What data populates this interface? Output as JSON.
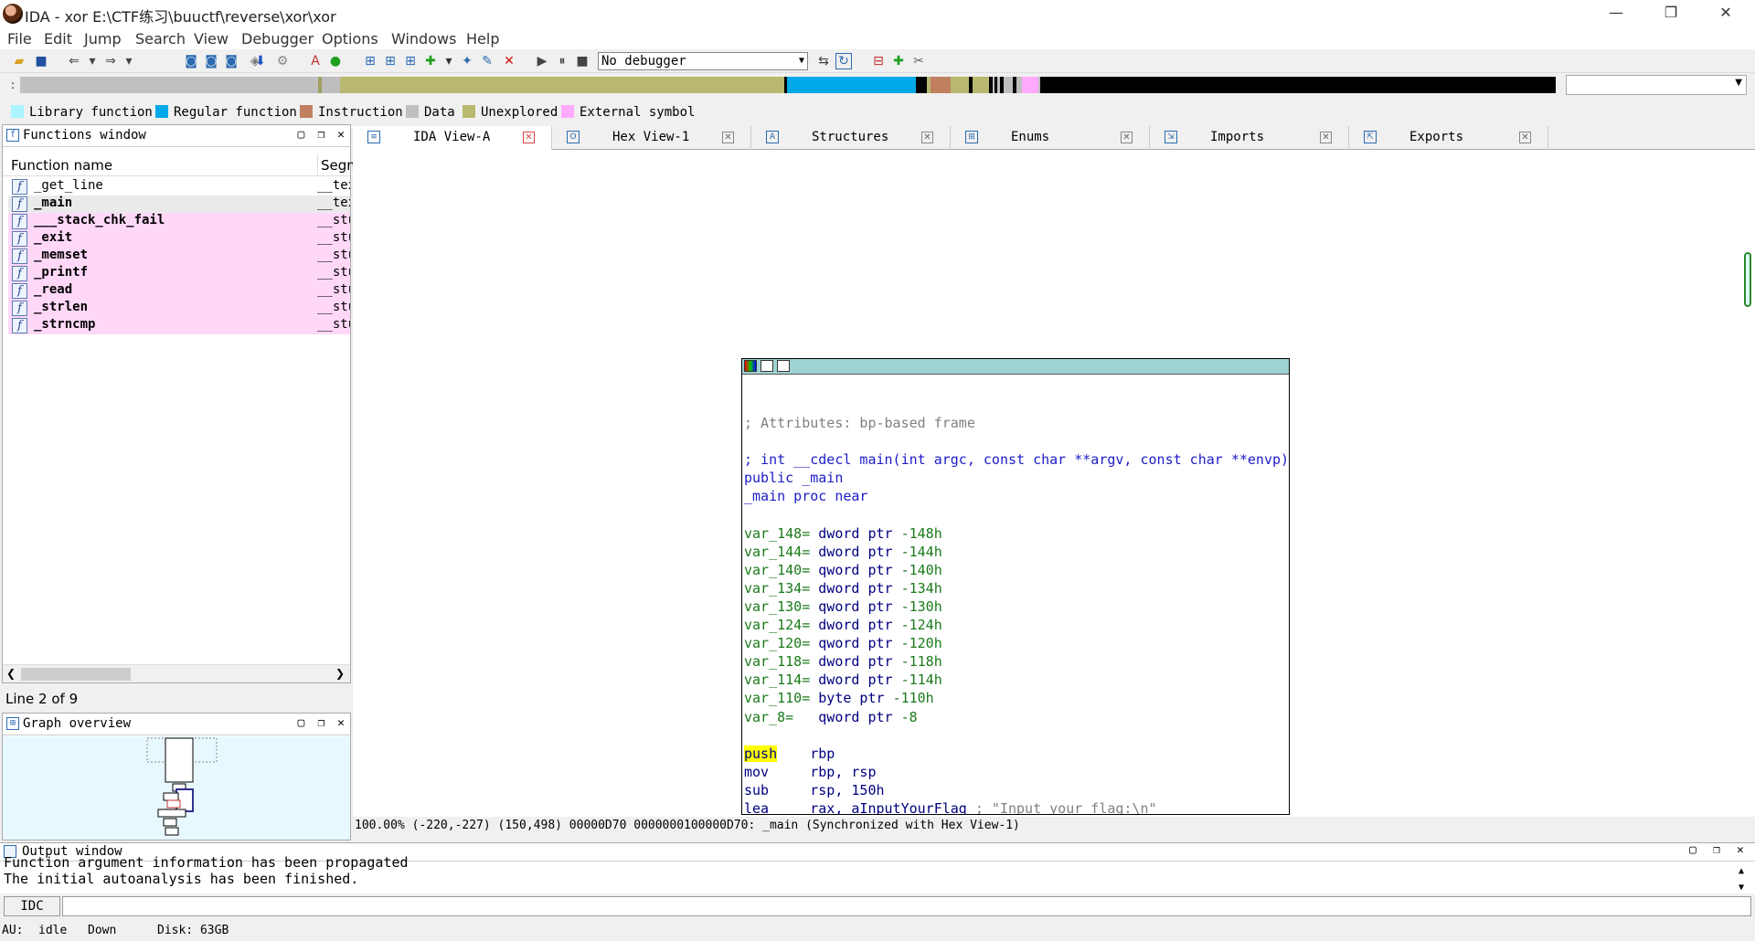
{
  "window": {
    "title": "IDA - xor E:\\CTF练习\\buuctf\\reverse\\xor\\xor",
    "minimize": "—",
    "restore": "❐",
    "close": "✕"
  },
  "menu": [
    "File",
    "Edit",
    "Jump",
    "Search",
    "View",
    "Debugger",
    "Options",
    "Windows",
    "Help"
  ],
  "toolbar": {
    "debugger_select": "No debugger"
  },
  "legend": [
    {
      "label": "Library function",
      "color": "#aaf5ff"
    },
    {
      "label": "Regular function",
      "color": "#00a8e8"
    },
    {
      "label": "Instruction",
      "color": "#c08060"
    },
    {
      "label": "Data",
      "color": "#c0c0c0"
    },
    {
      "label": "Unexplored",
      "color": "#b8b870"
    },
    {
      "label": "External symbol",
      "color": "#ffaaff"
    }
  ],
  "functions_window": {
    "title": "Functions window",
    "col_name": "Function name",
    "col_segment": "Segm",
    "rows": [
      {
        "name": "_get_line",
        "segment": "__text",
        "style": "plain"
      },
      {
        "name": "_main",
        "segment": "__text",
        "style": "sel"
      },
      {
        "name": "___stack_chk_fail",
        "segment": "__stubs",
        "style": "pink"
      },
      {
        "name": "_exit",
        "segment": "__stubs",
        "style": "pink"
      },
      {
        "name": "_memset",
        "segment": "__stubs",
        "style": "pink"
      },
      {
        "name": "_printf",
        "segment": "__stubs",
        "style": "pink"
      },
      {
        "name": "_read",
        "segment": "__stubs",
        "style": "pink"
      },
      {
        "name": "_strlen",
        "segment": "__stubs",
        "style": "pink"
      },
      {
        "name": "_strncmp",
        "segment": "__stubs",
        "style": "pink"
      }
    ],
    "line_status": "Line 2 of 9"
  },
  "graph_overview": {
    "title": "Graph overview"
  },
  "tabs": [
    {
      "label": "IDA View-A",
      "active": true
    },
    {
      "label": "Hex View-1",
      "active": false
    },
    {
      "label": "Structures",
      "active": false
    },
    {
      "label": "Enums",
      "active": false
    },
    {
      "label": "Imports",
      "active": false
    },
    {
      "label": "Exports",
      "active": false
    }
  ],
  "asm": {
    "attr": "; Attributes: bp-based frame",
    "proto": "; int __cdecl main(int argc, const char **argv, const char **envp)",
    "public": "public _main",
    "proc": "_main proc near",
    "vars": [
      {
        "name": "var_148",
        "type": "dword ptr",
        "off": "-148h"
      },
      {
        "name": "var_144",
        "type": "dword ptr",
        "off": "-144h"
      },
      {
        "name": "var_140",
        "type": "qword ptr",
        "off": "-140h"
      },
      {
        "name": "var_134",
        "type": "dword ptr",
        "off": "-134h"
      },
      {
        "name": "var_130",
        "type": "qword ptr",
        "off": "-130h"
      },
      {
        "name": "var_124",
        "type": "dword ptr",
        "off": "-124h"
      },
      {
        "name": "var_120",
        "type": "qword ptr",
        "off": "-120h"
      },
      {
        "name": "var_118",
        "type": "dword ptr",
        "off": "-118h"
      },
      {
        "name": "var_114",
        "type": "dword ptr",
        "off": "-114h"
      },
      {
        "name": "var_110",
        "type": "byte ptr",
        "off": "-110h"
      },
      {
        "name": "var_8",
        "type": "qword ptr",
        "off": "-8"
      }
    ],
    "instructions": [
      {
        "op": "push",
        "args": "rbp",
        "comment": ""
      },
      {
        "op": "mov",
        "args": "rbp, rsp",
        "comment": ""
      },
      {
        "op": "sub",
        "args": "rsp, 150h",
        "comment": ""
      },
      {
        "op": "lea",
        "args": "rax, aInputYourFlag",
        "comment": "; \"Input your flag:\\n\""
      }
    ]
  },
  "view_status": "100.00% (-220,-227) (150,498) 00000D70 0000000100000D70: _main (Synchronized with Hex View-1)",
  "output_window": {
    "title": "Output window",
    "lines": [
      "Function argument information has been propagated",
      "The initial autoanalysis has been finished."
    ],
    "idc_label": "IDC"
  },
  "statusbar": {
    "au": "AU:",
    "state": "idle",
    "direction": "Down",
    "disk": "Disk: 63GB"
  }
}
